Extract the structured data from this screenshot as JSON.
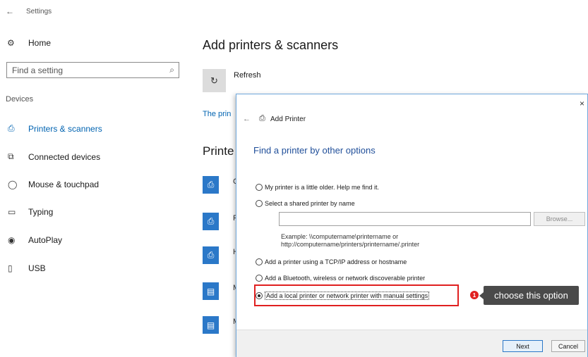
{
  "window": {
    "back_icon": "back-arrow-icon",
    "title": "Settings"
  },
  "sidebar": {
    "home_label": "Home",
    "search_placeholder": "Find a setting",
    "section_label": "Devices",
    "items": [
      {
        "label": "Printers & scanners",
        "icon": "printer-icon",
        "active": true
      },
      {
        "label": "Connected devices",
        "icon": "connected-devices-icon",
        "active": false
      },
      {
        "label": "Mouse & touchpad",
        "icon": "mouse-icon",
        "active": false
      },
      {
        "label": "Typing",
        "icon": "keyboard-icon",
        "active": false
      },
      {
        "label": "AutoPlay",
        "icon": "autoplay-icon",
        "active": false
      },
      {
        "label": "USB",
        "icon": "usb-icon",
        "active": false
      }
    ]
  },
  "main": {
    "title": "Add printers & scanners",
    "refresh_label": "Refresh",
    "partial_link": "The prin",
    "partial_section": "Printe",
    "printer_initials": [
      "C",
      "F",
      "H",
      "M",
      "M"
    ]
  },
  "dialog": {
    "title": "Add Printer",
    "heading": "Find a printer by other options",
    "options": [
      {
        "label": "My printer is a little older. Help me find it.",
        "checked": false
      },
      {
        "label": "Select a shared printer by name",
        "checked": false
      },
      {
        "label": "Add a printer using a TCP/IP address or hostname",
        "checked": false
      },
      {
        "label": "Add a Bluetooth, wireless or network discoverable printer",
        "checked": false
      },
      {
        "label": "Add a local printer or network printer with manual settings",
        "checked": true
      }
    ],
    "shared_input_value": "",
    "browse_label": "Browse...",
    "example_line1": "Example: \\\\computername\\printername or",
    "example_line2": "http://computername/printers/printername/.printer",
    "next_label": "Next",
    "cancel_label": "Cancel"
  },
  "annotation": {
    "number": "1",
    "text": "choose this option",
    "color": "#e02020"
  }
}
